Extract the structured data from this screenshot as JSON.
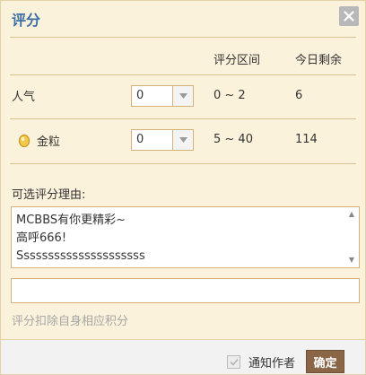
{
  "dialog": {
    "title": "评分",
    "close_icon": "close-icon"
  },
  "table": {
    "headers": {
      "range": "评分区间",
      "remaining": "今日剩余"
    },
    "rows": [
      {
        "label": "人气",
        "icon": null,
        "value": "0",
        "range": "0 ~ 2",
        "remaining": "6"
      },
      {
        "label": "金粒",
        "icon": "gold-coin-icon",
        "value": "0",
        "range": "5 ~ 40",
        "remaining": "114"
      }
    ]
  },
  "reason": {
    "label": "可选评分理由:",
    "lines": [
      "MCBBS有你更精彩~",
      "高呼666!",
      "Sssssssssssssssssssss"
    ],
    "custom_value": ""
  },
  "hint": "评分扣除自身相应积分",
  "footer": {
    "notify_label": "通知作者",
    "notify_checked": true,
    "ok_label": "确定"
  },
  "colors": {
    "background": "#fbf2db",
    "title": "#3a6ea5",
    "border": "#d4b27a",
    "ok_button": "#8a6546"
  }
}
